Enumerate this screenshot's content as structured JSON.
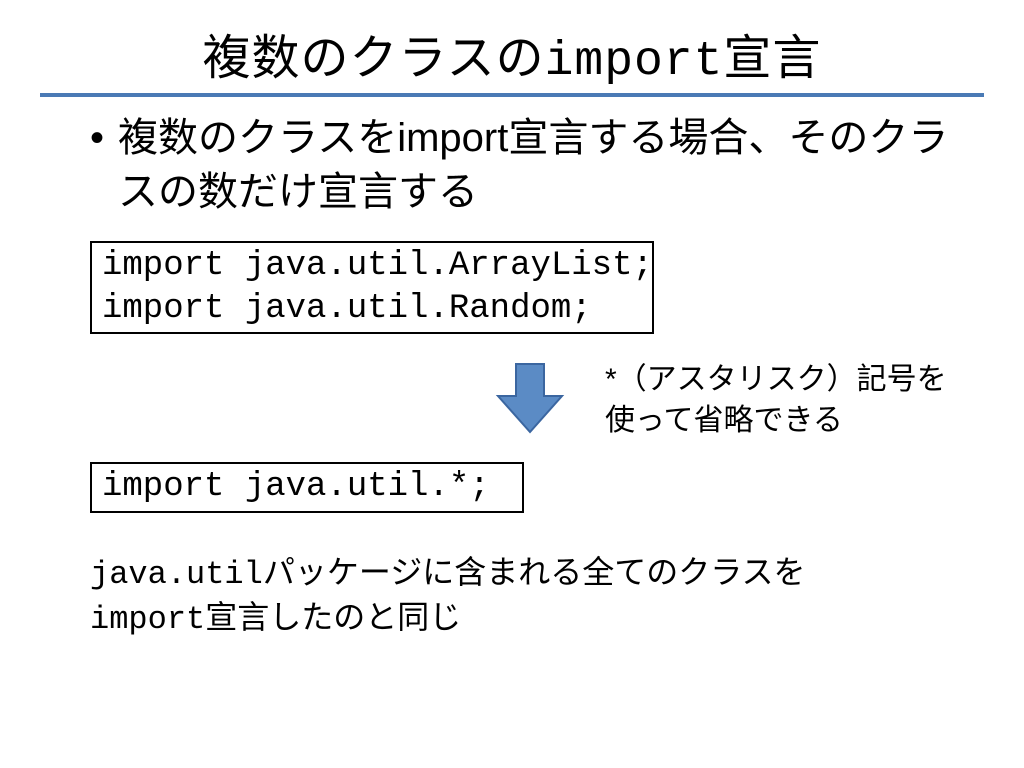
{
  "title_pre": "複数のクラスの",
  "title_code": "import",
  "title_post": "宣言",
  "bullet_pre": "複数のクラスを",
  "bullet_code": "import",
  "bullet_post": "宣言する場合、そのクラスの数だけ宣言する",
  "code1": "import java.util.ArrayList;\nimport java.util.Random;",
  "annotation": "*（アスタリスク）記号を使って省略できる",
  "code2": "import java.util.*;",
  "foot_code1": "java.util",
  "foot_mid": "パッケージに含まれる全てのクラスを",
  "foot_code2": "import",
  "foot_post": "宣言したのと同じ"
}
